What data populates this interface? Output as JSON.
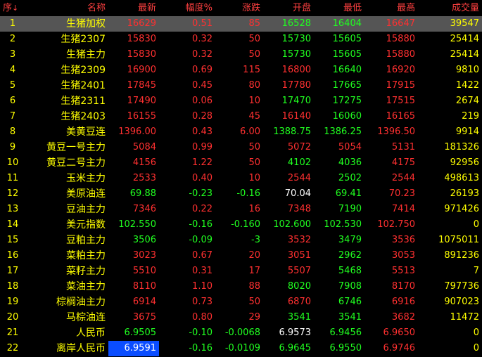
{
  "header": {
    "seq": "序",
    "seq_sort_icon": "↓",
    "name": "名称",
    "last": "最新",
    "pct": "幅度%",
    "chg": "涨跌",
    "open": "开盘",
    "low": "最低",
    "high": "最高",
    "volume": "成交量"
  },
  "colors": {
    "up": "#ff3030",
    "down": "#20ff20",
    "flat": "#ffffff",
    "name": "#ffff00",
    "header": "#ff4040",
    "selected_row": "#555555",
    "highlight_cell": "#0a4dff"
  },
  "rows": [
    {
      "seq": "1",
      "name": "生猪加权",
      "last": "16629",
      "pct": "0.51",
      "chg": "85",
      "open": "16528",
      "low": "16404",
      "high": "16647",
      "volume": "39547",
      "last_c": "up",
      "pct_c": "up",
      "chg_c": "up",
      "open_c": "down",
      "low_c": "down",
      "high_c": "up",
      "selected": true
    },
    {
      "seq": "2",
      "name": "生猪2307",
      "last": "15830",
      "pct": "0.32",
      "chg": "50",
      "open": "15730",
      "low": "15605",
      "high": "15880",
      "volume": "25414",
      "last_c": "up",
      "pct_c": "up",
      "chg_c": "up",
      "open_c": "down",
      "low_c": "down",
      "high_c": "up"
    },
    {
      "seq": "3",
      "name": "生猪主力",
      "last": "15830",
      "pct": "0.32",
      "chg": "50",
      "open": "15730",
      "low": "15605",
      "high": "15880",
      "volume": "25414",
      "last_c": "up",
      "pct_c": "up",
      "chg_c": "up",
      "open_c": "down",
      "low_c": "down",
      "high_c": "up"
    },
    {
      "seq": "4",
      "name": "生猪2309",
      "last": "16900",
      "pct": "0.69",
      "chg": "115",
      "open": "16800",
      "low": "16640",
      "high": "16920",
      "volume": "9810",
      "last_c": "up",
      "pct_c": "up",
      "chg_c": "up",
      "open_c": "up",
      "low_c": "down",
      "high_c": "up"
    },
    {
      "seq": "5",
      "name": "生猪2401",
      "last": "17845",
      "pct": "0.45",
      "chg": "80",
      "open": "17780",
      "low": "17665",
      "high": "17915",
      "volume": "1422",
      "last_c": "up",
      "pct_c": "up",
      "chg_c": "up",
      "open_c": "up",
      "low_c": "down",
      "high_c": "up"
    },
    {
      "seq": "6",
      "name": "生猪2311",
      "last": "17490",
      "pct": "0.06",
      "chg": "10",
      "open": "17470",
      "low": "17275",
      "high": "17515",
      "volume": "2674",
      "last_c": "up",
      "pct_c": "up",
      "chg_c": "up",
      "open_c": "down",
      "low_c": "down",
      "high_c": "up"
    },
    {
      "seq": "7",
      "name": "生猪2403",
      "last": "16155",
      "pct": "0.28",
      "chg": "45",
      "open": "16140",
      "low": "16060",
      "high": "16165",
      "volume": "219",
      "last_c": "up",
      "pct_c": "up",
      "chg_c": "up",
      "open_c": "up",
      "low_c": "down",
      "high_c": "up"
    },
    {
      "seq": "8",
      "name": "美黄豆连",
      "last": "1396.00",
      "pct": "0.43",
      "chg": "6.00",
      "open": "1388.75",
      "low": "1386.25",
      "high": "1396.50",
      "volume": "9914",
      "last_c": "up",
      "pct_c": "up",
      "chg_c": "up",
      "open_c": "down",
      "low_c": "down",
      "high_c": "up"
    },
    {
      "seq": "9",
      "name": "黄豆一号主力",
      "last": "5084",
      "pct": "0.99",
      "chg": "50",
      "open": "5072",
      "low": "5054",
      "high": "5131",
      "volume": "181326",
      "last_c": "up",
      "pct_c": "up",
      "chg_c": "up",
      "open_c": "up",
      "low_c": "up",
      "high_c": "up"
    },
    {
      "seq": "10",
      "name": "黄豆二号主力",
      "last": "4156",
      "pct": "1.22",
      "chg": "50",
      "open": "4102",
      "low": "4036",
      "high": "4175",
      "volume": "92956",
      "last_c": "up",
      "pct_c": "up",
      "chg_c": "up",
      "open_c": "down",
      "low_c": "down",
      "high_c": "up"
    },
    {
      "seq": "11",
      "name": "玉米主力",
      "last": "2533",
      "pct": "0.40",
      "chg": "10",
      "open": "2544",
      "low": "2502",
      "high": "2544",
      "volume": "498613",
      "last_c": "up",
      "pct_c": "up",
      "chg_c": "up",
      "open_c": "up",
      "low_c": "down",
      "high_c": "up"
    },
    {
      "seq": "12",
      "name": "美原油连",
      "last": "69.88",
      "pct": "-0.23",
      "chg": "-0.16",
      "open": "70.04",
      "low": "69.41",
      "high": "70.23",
      "volume": "26193",
      "last_c": "down",
      "pct_c": "down",
      "chg_c": "down",
      "open_c": "flat",
      "low_c": "down",
      "high_c": "up"
    },
    {
      "seq": "13",
      "name": "豆油主力",
      "last": "7346",
      "pct": "0.22",
      "chg": "16",
      "open": "7348",
      "low": "7190",
      "high": "7414",
      "volume": "971426",
      "last_c": "up",
      "pct_c": "up",
      "chg_c": "up",
      "open_c": "up",
      "low_c": "down",
      "high_c": "up"
    },
    {
      "seq": "14",
      "name": "美元指数",
      "last": "102.550",
      "pct": "-0.16",
      "chg": "-0.160",
      "open": "102.600",
      "low": "102.530",
      "high": "102.750",
      "volume": "0",
      "last_c": "down",
      "pct_c": "down",
      "chg_c": "down",
      "open_c": "down",
      "low_c": "down",
      "high_c": "up"
    },
    {
      "seq": "15",
      "name": "豆粕主力",
      "last": "3506",
      "pct": "-0.09",
      "chg": "-3",
      "open": "3532",
      "low": "3479",
      "high": "3536",
      "volume": "1075011",
      "last_c": "down",
      "pct_c": "down",
      "chg_c": "down",
      "open_c": "up",
      "low_c": "down",
      "high_c": "up"
    },
    {
      "seq": "16",
      "name": "菜粕主力",
      "last": "3023",
      "pct": "0.67",
      "chg": "20",
      "open": "3051",
      "low": "2962",
      "high": "3053",
      "volume": "891236",
      "last_c": "up",
      "pct_c": "up",
      "chg_c": "up",
      "open_c": "up",
      "low_c": "down",
      "high_c": "up"
    },
    {
      "seq": "17",
      "name": "菜籽主力",
      "last": "5510",
      "pct": "0.31",
      "chg": "17",
      "open": "5507",
      "low": "5468",
      "high": "5513",
      "volume": "7",
      "last_c": "up",
      "pct_c": "up",
      "chg_c": "up",
      "open_c": "up",
      "low_c": "down",
      "high_c": "up"
    },
    {
      "seq": "18",
      "name": "菜油主力",
      "last": "8110",
      "pct": "1.10",
      "chg": "88",
      "open": "8020",
      "low": "7908",
      "high": "8170",
      "volume": "797736",
      "last_c": "up",
      "pct_c": "up",
      "chg_c": "up",
      "open_c": "down",
      "low_c": "down",
      "high_c": "up"
    },
    {
      "seq": "19",
      "name": "棕榈油主力",
      "last": "6914",
      "pct": "0.73",
      "chg": "50",
      "open": "6870",
      "low": "6746",
      "high": "6916",
      "volume": "907023",
      "last_c": "up",
      "pct_c": "up",
      "chg_c": "up",
      "open_c": "up",
      "low_c": "down",
      "high_c": "up"
    },
    {
      "seq": "20",
      "name": "马棕油连",
      "last": "3675",
      "pct": "0.80",
      "chg": "29",
      "open": "3541",
      "low": "3541",
      "high": "3682",
      "volume": "11472",
      "last_c": "up",
      "pct_c": "up",
      "chg_c": "up",
      "open_c": "down",
      "low_c": "down",
      "high_c": "up"
    },
    {
      "seq": "21",
      "name": "人民币",
      "last": "6.9505",
      "pct": "-0.10",
      "chg": "-0.0068",
      "open": "6.9573",
      "low": "6.9456",
      "high": "6.9650",
      "volume": "0",
      "last_c": "down",
      "pct_c": "down",
      "chg_c": "down",
      "open_c": "flat",
      "low_c": "down",
      "high_c": "up"
    },
    {
      "seq": "22",
      "name": "离岸人民币",
      "last": "6.9591",
      "pct": "-0.16",
      "chg": "-0.0109",
      "open": "6.9645",
      "low": "6.9550",
      "high": "6.9746",
      "volume": "0",
      "last_c": "down",
      "pct_c": "down",
      "chg_c": "down",
      "open_c": "down",
      "low_c": "down",
      "high_c": "up",
      "highlight_last": true
    }
  ]
}
